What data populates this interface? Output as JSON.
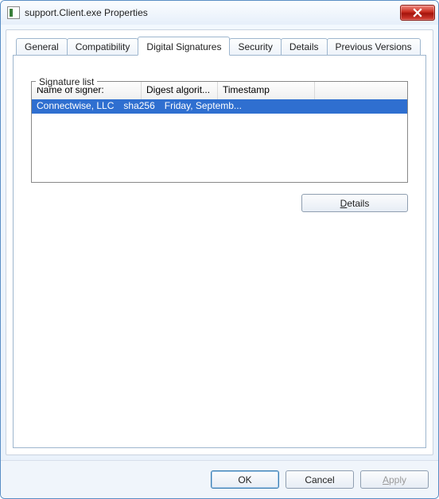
{
  "window": {
    "title": "support.Client.exe Properties"
  },
  "tabs": {
    "general": "General",
    "compat": "Compatibility",
    "digsig": "Digital Signatures",
    "security": "Security",
    "details": "Details",
    "prev": "Previous Versions"
  },
  "group": {
    "label": "Signature list"
  },
  "columns": {
    "signer": "Name of signer:",
    "digest": "Digest algorit...",
    "timestamp": "Timestamp"
  },
  "rows": [
    {
      "signer": "Connectwise, LLC",
      "digest": "sha256",
      "timestamp": "Friday, Septemb..."
    }
  ],
  "buttons": {
    "details_pre": "",
    "details_u": "D",
    "details_post": "etails",
    "ok": "OK",
    "cancel": "Cancel",
    "apply_u": "A",
    "apply_post": "pply"
  }
}
